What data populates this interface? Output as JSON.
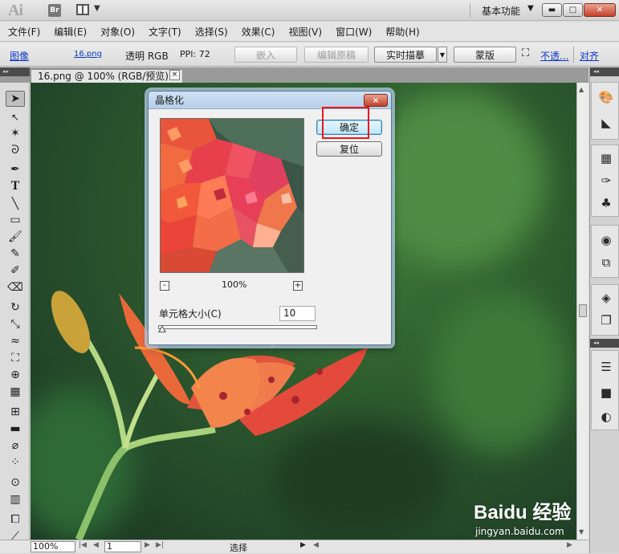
{
  "app": {
    "logo": "Ai",
    "bridge_label": "Br",
    "workspace": "基本功能"
  },
  "menu": [
    "文件(F)",
    "编辑(E)",
    "对象(O)",
    "文字(T)",
    "选择(S)",
    "效果(C)",
    "视图(V)",
    "窗口(W)",
    "帮助(H)"
  ],
  "control_bar": {
    "object_type": "图像",
    "file_name": "16.png",
    "mode": "透明 RGB",
    "ppi": "PPI: 72",
    "embed": "嵌入",
    "edit_original": "编辑原稿",
    "live_trace": "实时描摹",
    "mask": "蒙版",
    "opacity": "不透...",
    "align": "对齐"
  },
  "document_tab": {
    "title": "16.png @ 100% (RGB/预览)",
    "close": "×"
  },
  "dialog": {
    "title": "晶格化",
    "ok": "确定",
    "reset": "复位",
    "zoom_out": "-",
    "zoom_in": "+",
    "zoom": "100%",
    "cell_size_label": "单元格大小(C)",
    "cell_size_value": "10",
    "cell_size_slider_fraction": 0.0,
    "close": "×"
  },
  "status_bar": {
    "zoom": "100%",
    "artboard": "1",
    "tool_status": "选择"
  },
  "watermark": {
    "brand": "Baidu 经验",
    "url": "jingyan.baidu.com"
  },
  "colors": {
    "highlight_box": "#e8161b",
    "link": "#0b37c8",
    "dialog_title_bg": "#c3d8ef",
    "foliage": "#2f5f2e"
  }
}
